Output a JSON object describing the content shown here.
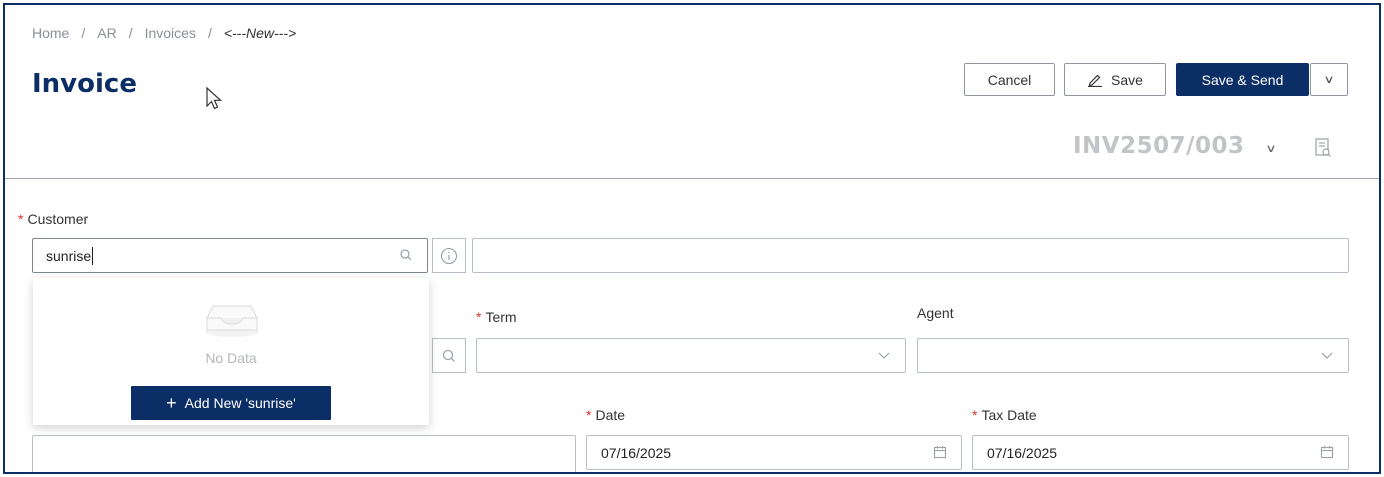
{
  "breadcrumb": {
    "items": [
      "Home",
      "AR",
      "Invoices"
    ],
    "separator": "/",
    "current": "<---New--->"
  },
  "page": {
    "title": "Invoice"
  },
  "toolbar": {
    "cancel_label": "Cancel",
    "save_label": "Save",
    "save_send_label": "Save & Send"
  },
  "document": {
    "number": "INV2507/003"
  },
  "form": {
    "customer": {
      "label": "Customer",
      "required_mark": "*",
      "value": "sunrise"
    },
    "term": {
      "label": "Term",
      "required_mark": "*",
      "value": ""
    },
    "agent": {
      "label": "Agent",
      "value": ""
    },
    "date": {
      "label": "Date",
      "required_mark": "*",
      "value": "07/16/2025"
    },
    "tax_date": {
      "label": "Tax Date",
      "required_mark": "*",
      "value": "07/16/2025"
    }
  },
  "customer_dropdown": {
    "empty_text": "No Data",
    "add_new_label": "Add New 'sunrise'"
  },
  "colors": {
    "brand_navy": "#0b2e66",
    "required_red": "#e0312b",
    "muted_text": "#8a8f98"
  },
  "icons": [
    "search-icon",
    "info-icon",
    "chevron-down-icon",
    "calendar-icon",
    "document-search-icon",
    "empty-inbox-icon",
    "pen-icon",
    "plus-icon"
  ]
}
